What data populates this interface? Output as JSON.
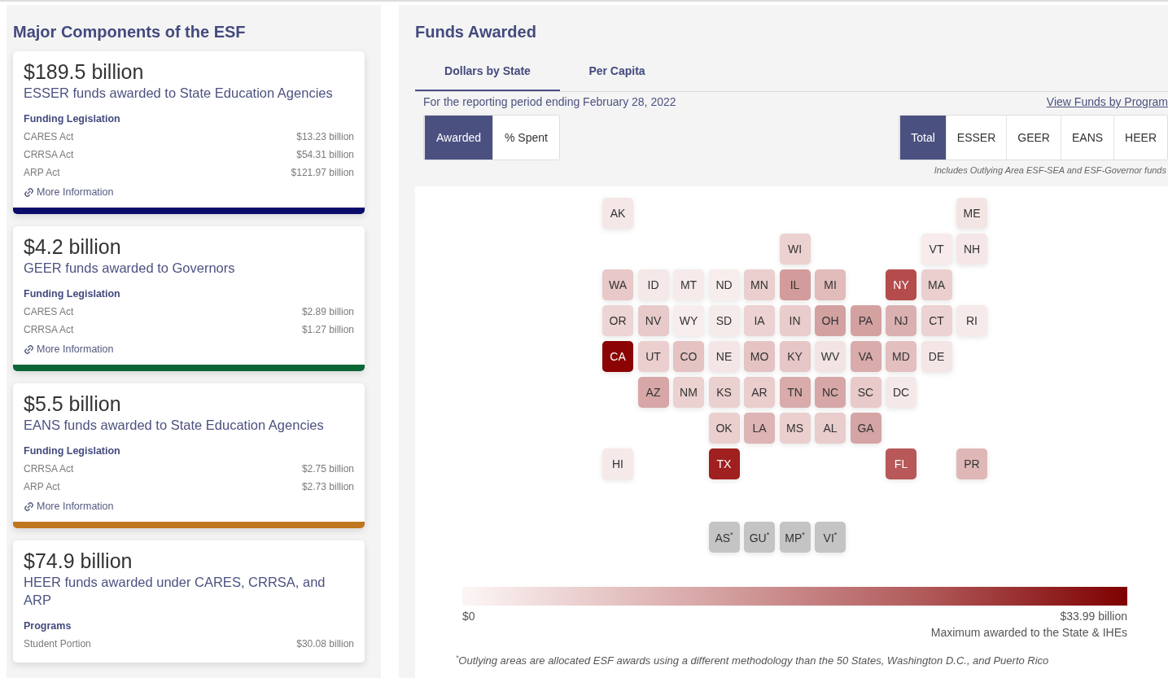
{
  "components": {
    "title": "Major Components of the ESF",
    "cards": [
      {
        "amount": "$189.5 billion",
        "description": "ESSER funds awarded to State Education Agencies",
        "section": "Funding Legislation",
        "rows": [
          {
            "label": "CARES Act",
            "value": "$13.23 billion"
          },
          {
            "label": "CRRSA Act",
            "value": "$54.31 billion"
          },
          {
            "label": "ARP Act",
            "value": "$121.97 billion"
          }
        ],
        "link": "More Information",
        "color": "#0b0b6b"
      },
      {
        "amount": "$4.2 billion",
        "description": "GEER funds awarded to Governors",
        "section": "Funding Legislation",
        "rows": [
          {
            "label": "CARES Act",
            "value": "$2.89 billion"
          },
          {
            "label": "CRRSA Act",
            "value": "$1.27 billion"
          }
        ],
        "link": "More Information",
        "color": "#0a6634"
      },
      {
        "amount": "$5.5 billion",
        "description": "EANS funds awarded to State Education Agencies",
        "section": "Funding Legislation",
        "rows": [
          {
            "label": "CRRSA Act",
            "value": "$2.75 billion"
          },
          {
            "label": "ARP Act",
            "value": "$2.73 billion"
          }
        ],
        "link": "More Information",
        "color": "#c0761e"
      },
      {
        "amount": "$74.9 billion",
        "description": "HEER funds awarded under CARES, CRRSA, and ARP",
        "section": "Programs",
        "rows": [
          {
            "label": "Student Portion",
            "value": "$30.08 billion"
          }
        ]
      }
    ]
  },
  "funds": {
    "title": "Funds Awarded",
    "tabs": [
      {
        "label": "Dollars by State",
        "selected": true
      },
      {
        "label": "Per Capita",
        "selected": false
      }
    ],
    "period": "For the reporting period ending February 28, 2022",
    "program_link": "View Funds by Program",
    "measure_toggle": [
      {
        "label": "Awarded",
        "selected": true
      },
      {
        "label": "% Spent",
        "selected": false
      }
    ],
    "program_toggle": [
      {
        "label": "Total",
        "selected": true
      },
      {
        "label": "ESSER",
        "selected": false
      },
      {
        "label": "GEER",
        "selected": false
      },
      {
        "label": "EANS",
        "selected": false
      },
      {
        "label": "HEER",
        "selected": false
      }
    ],
    "program_note": "Includes Outlying Area ESF-SEA and ESF-Governor funds",
    "tiles": [
      {
        "label": "AK",
        "color": "#f5e7e7"
      },
      {
        "label": "ME",
        "color": "#f4e5e5"
      },
      {
        "label": "WI",
        "color": "#ecd1d1"
      },
      {
        "label": "VT",
        "color": "#f7ebeb"
      },
      {
        "label": "NH",
        "color": "#f5e7e7"
      },
      {
        "label": "WA",
        "color": "#e8c8c8"
      },
      {
        "label": "ID",
        "color": "#f5e8e8"
      },
      {
        "label": "MT",
        "color": "#f6eaea"
      },
      {
        "label": "ND",
        "color": "#f7eded"
      },
      {
        "label": "MN",
        "color": "#ebcfcf"
      },
      {
        "label": "IL",
        "color": "#d39b9b"
      },
      {
        "label": "MI",
        "color": "#e2bbbb"
      },
      {
        "label": "NY",
        "color": "#b44c4c"
      },
      {
        "label": "MA",
        "color": "#ebcfcf"
      },
      {
        "label": "OR",
        "color": "#edd5d5"
      },
      {
        "label": "NV",
        "color": "#e8caca"
      },
      {
        "label": "WY",
        "color": "#f7eded"
      },
      {
        "label": "SD",
        "color": "#f6ebeb"
      },
      {
        "label": "IA",
        "color": "#ecd2d2"
      },
      {
        "label": "IN",
        "color": "#e9cccc"
      },
      {
        "label": "OH",
        "color": "#d4a1a1"
      },
      {
        "label": "PA",
        "color": "#d4a1a1"
      },
      {
        "label": "NJ",
        "color": "#dbb0b0"
      },
      {
        "label": "CT",
        "color": "#ecd2d2"
      },
      {
        "label": "RI",
        "color": "#f6eaea"
      },
      {
        "label": "CA",
        "color": "#8b0303"
      },
      {
        "label": "UT",
        "color": "#ebcfcf"
      },
      {
        "label": "CO",
        "color": "#e5c3c3"
      },
      {
        "label": "NE",
        "color": "#f4e6e6"
      },
      {
        "label": "MO",
        "color": "#e5c3c3"
      },
      {
        "label": "KY",
        "color": "#e6c6c6"
      },
      {
        "label": "WV",
        "color": "#f3e4e4"
      },
      {
        "label": "VA",
        "color": "#d9abab"
      },
      {
        "label": "MD",
        "color": "#e3bfbf"
      },
      {
        "label": "DE",
        "color": "#f4e6e6"
      },
      {
        "label": "AZ",
        "color": "#d7a7a7"
      },
      {
        "label": "NM",
        "color": "#ecd1d1"
      },
      {
        "label": "KS",
        "color": "#ebd0d0"
      },
      {
        "label": "AR",
        "color": "#eacdcd"
      },
      {
        "label": "TN",
        "color": "#d9abab"
      },
      {
        "label": "NC",
        "color": "#d7a7a7"
      },
      {
        "label": "SC",
        "color": "#e8caca"
      },
      {
        "label": "DC",
        "color": "#f5e8e8"
      },
      {
        "label": "OK",
        "color": "#ebcfcf"
      },
      {
        "label": "LA",
        "color": "#deb4b4"
      },
      {
        "label": "MS",
        "color": "#ebcfcf"
      },
      {
        "label": "AL",
        "color": "#e9cccc"
      },
      {
        "label": "GA",
        "color": "#d5a4a4"
      },
      {
        "label": "HI",
        "color": "#f6e9e9"
      },
      {
        "label": "TX",
        "color": "#a01f1f"
      },
      {
        "label": "FL",
        "color": "#b85858"
      },
      {
        "label": "PR",
        "color": "#dfb7b7"
      },
      {
        "label": "AS$^{*}$",
        "color": "#c4c4c4"
      },
      {
        "label": "GU$^{*}$",
        "color": "#c4c4c4"
      },
      {
        "label": "MP$^{*}$",
        "color": "#c4c4c4"
      },
      {
        "label": "VI$^{*}$",
        "color": "#c4c4c4"
      }
    ],
    "legend": {
      "min": "$0",
      "max": "$33.99 billion",
      "caption": "Maximum awarded to the State & IHEs"
    },
    "footnote": "$^{*}$Outlying areas are allocated ESF awards using a different methodology than the 50 States, Washington D.C., and Puerto Rico"
  }
}
